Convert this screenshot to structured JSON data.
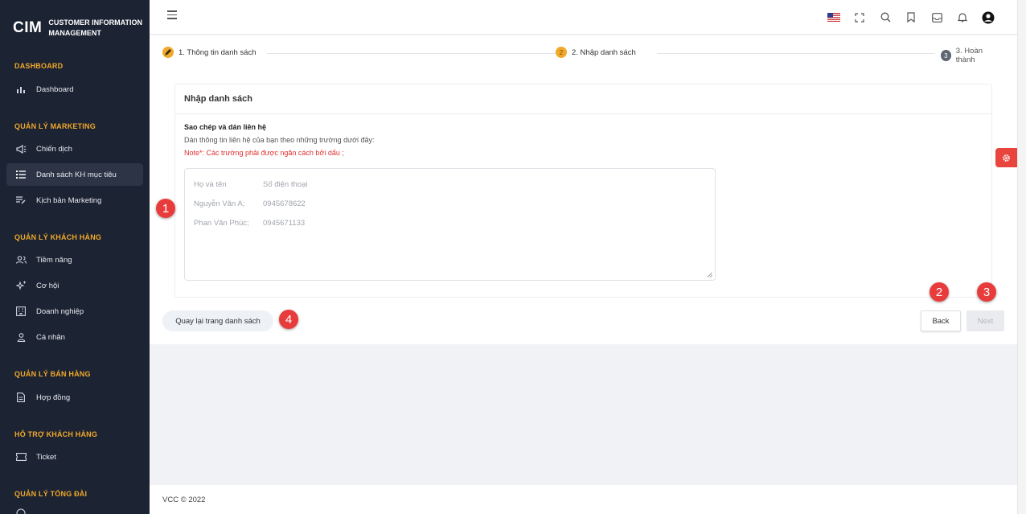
{
  "brand": {
    "logo": "CIM",
    "line1": "CUSTOMER INFORMATION",
    "line2": "MANAGEMENT"
  },
  "sidebar": {
    "sections": [
      {
        "title": "DASHBOARD",
        "items": [
          {
            "label": "Dashboard",
            "icon": "bar-chart-icon"
          }
        ]
      },
      {
        "title": "QUẢN LÝ MARKETING",
        "items": [
          {
            "label": "Chiến dịch",
            "icon": "megaphone-icon"
          },
          {
            "label": "Danh sách KH mục tiêu",
            "icon": "list-icon",
            "active": true
          },
          {
            "label": "Kịch bản Marketing",
            "icon": "script-icon"
          }
        ]
      },
      {
        "title": "QUẢN LÝ KHÁCH HÀNG",
        "items": [
          {
            "label": "Tiềm năng",
            "icon": "users-icon"
          },
          {
            "label": "Cơ hội",
            "icon": "sparkle-icon"
          },
          {
            "label": "Doanh nghiệp",
            "icon": "building-icon"
          },
          {
            "label": "Cá nhân",
            "icon": "user-icon"
          }
        ]
      },
      {
        "title": "QUẢN LÝ BÁN HÀNG",
        "items": [
          {
            "label": "Hợp đồng",
            "icon": "document-icon"
          }
        ]
      },
      {
        "title": "HỖ TRỢ KHÁCH HÀNG",
        "items": [
          {
            "label": "Ticket",
            "icon": "ticket-icon"
          }
        ]
      },
      {
        "title": "QUẢN LÝ TỔNG ĐÀI",
        "items": []
      }
    ]
  },
  "header": {
    "icons": [
      "us-flag-icon",
      "fullscreen-icon",
      "search-icon",
      "bookmark-icon",
      "inbox-icon",
      "bell-icon",
      "account-icon"
    ]
  },
  "stepper": {
    "steps": [
      {
        "label": "1. Thông tin danh sách",
        "state": "done"
      },
      {
        "label": "2. Nhập danh sách",
        "number": "2",
        "state": "active"
      },
      {
        "label": "3. Hoàn thành",
        "number": "3",
        "state": "pending"
      }
    ]
  },
  "panel": {
    "title": "Nhập danh sách",
    "subtitle": "Sao chép và dán liên hệ",
    "description": "Dán thông tin liên hệ của bạn theo những trường dưới đây:",
    "note": "Note*: Các trường phải được ngăn cách bởi dấu ;",
    "placeholder": {
      "rows": [
        [
          "Họ và tên",
          "Số điện thoại"
        ],
        [
          "Nguyễn Văn A;",
          "0945678622"
        ],
        [
          "Phan Văn Phúc;",
          "0945671133"
        ]
      ]
    }
  },
  "badges": [
    "1",
    "2",
    "3",
    "4"
  ],
  "buttons": {
    "return": "Quay lại trang danh sách",
    "back": "Back",
    "next": "Next"
  },
  "footer": {
    "text": "VCC © 2022"
  },
  "colors": {
    "sidebar_bg": "#1c2333",
    "section_title": "#f0a92a",
    "accent": "#f0a92a",
    "danger": "#e83c3c",
    "note": "#e0302e"
  }
}
